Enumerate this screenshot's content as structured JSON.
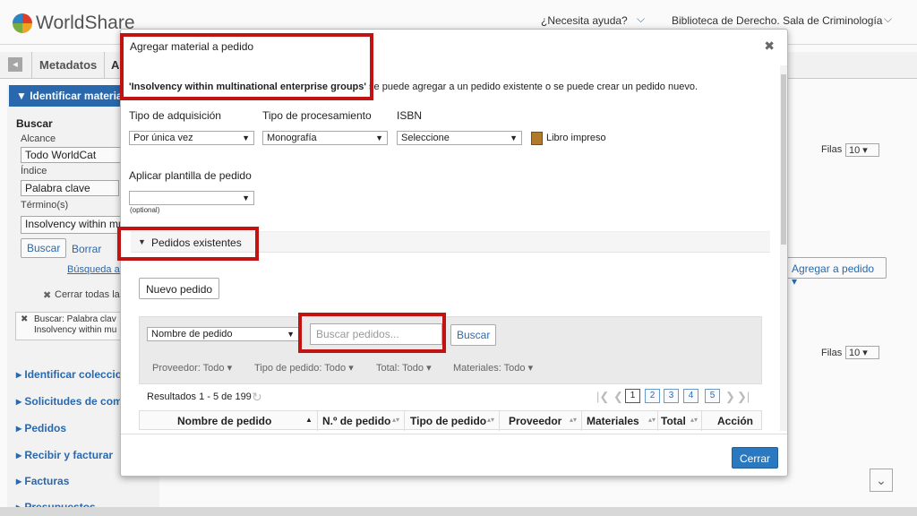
{
  "header": {
    "logo": "WorldShare",
    "help": "¿Necesita ayuda?",
    "library": "Biblioteca de Derecho. Sala de Criminología"
  },
  "tabs": {
    "metadatos": "Metadatos",
    "second_tab_partial": "A"
  },
  "sidebar": {
    "section_title": "Identificar material",
    "buscar_heading": "Buscar",
    "alcance_label": "Alcance",
    "alcance_value": "Todo WorldCat",
    "indice_label": "Índice",
    "indice_value": "Palabra clave",
    "termino_label": "Término(s)",
    "termino_value": "Insolvency within mult",
    "buscar_btn": "Buscar",
    "borrar_btn": "Borrar",
    "busqueda_link": "Búsqueda av",
    "cerrar_todas": "Cerrar todas las",
    "chip_line1": "Buscar: Palabra clav",
    "chip_line2": "Insolvency within mu",
    "items": [
      "Identificar coleccion",
      "Solicitudes de comp",
      "Pedidos",
      "Recibir y facturar",
      "Facturas",
      "Presupuestos"
    ]
  },
  "right": {
    "filas_label": "Filas",
    "filas_value": "10",
    "agregar_btn": "Agregar a pedido"
  },
  "modal": {
    "title": "Agregar material a pedido",
    "message_title": "'Insolvency within multinational enterprise groups'",
    "message_rest": " se puede agregar a un pedido existente o se puede crear un pedido nuevo.",
    "tipo_adquisicion_label": "Tipo de adquisición",
    "tipo_adquisicion_value": "Por única vez",
    "tipo_procesamiento_label": "Tipo de procesamiento",
    "tipo_procesamiento_value": "Monografía",
    "isbn_label": "ISBN",
    "isbn_value": "Seleccione",
    "format_label": "Libro impreso",
    "plantilla_label": "Aplicar plantilla de pedido",
    "plantilla_value": "",
    "optional": "(optional)",
    "pedidos_existentes": "Pedidos existentes",
    "nuevo_pedido": "Nuevo pedido",
    "search_by_value": "Nombre de pedido",
    "search_placeholder": "Buscar pedidos...",
    "buscar_btn": "Buscar",
    "filters": [
      "Proveedor: Todo",
      "Tipo de pedido: Todo",
      "Total: Todo",
      "Materiales: Todo"
    ],
    "results_text": "Resultados 1 - 5 de 199",
    "pages": [
      "1",
      "2",
      "3",
      "4",
      "5"
    ],
    "columns": [
      "Nombre de pedido",
      "N.º de pedido",
      "Tipo de pedido",
      "Proveedor",
      "Materiales",
      "Total",
      "Acción"
    ],
    "cerrar_btn": "Cerrar"
  },
  "colors": {
    "primary": "#2a78c0",
    "highlight": "#c21313"
  }
}
